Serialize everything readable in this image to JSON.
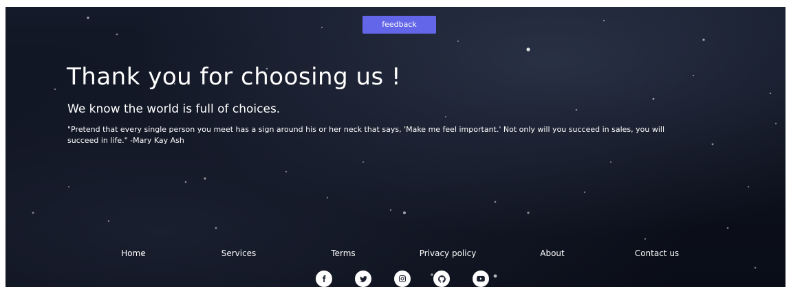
{
  "header": {
    "feedback_label": "feedback"
  },
  "hero": {
    "title": "Thank you for choosing us !",
    "subtitle": "We know the world is full of choices.",
    "quote": "\"Pretend that every single person you meet has a sign around his or her neck that says, 'Make me feel important.' Not only will you succeed in sales, you will succeed in life.\" -Mary Kay Ash"
  },
  "footer": {
    "nav": [
      {
        "label": "Home"
      },
      {
        "label": "Services"
      },
      {
        "label": "Terms"
      },
      {
        "label": "Privacy policy"
      },
      {
        "label": "About"
      },
      {
        "label": "Contact us"
      }
    ],
    "social": [
      {
        "icon": "facebook-icon"
      },
      {
        "icon": "twitter-icon"
      },
      {
        "icon": "instagram-icon"
      },
      {
        "icon": "github-icon"
      },
      {
        "icon": "youtube-icon"
      }
    ]
  },
  "colors": {
    "accent": "#6366e8",
    "background": "#0d111d",
    "text": "#ffffff"
  }
}
